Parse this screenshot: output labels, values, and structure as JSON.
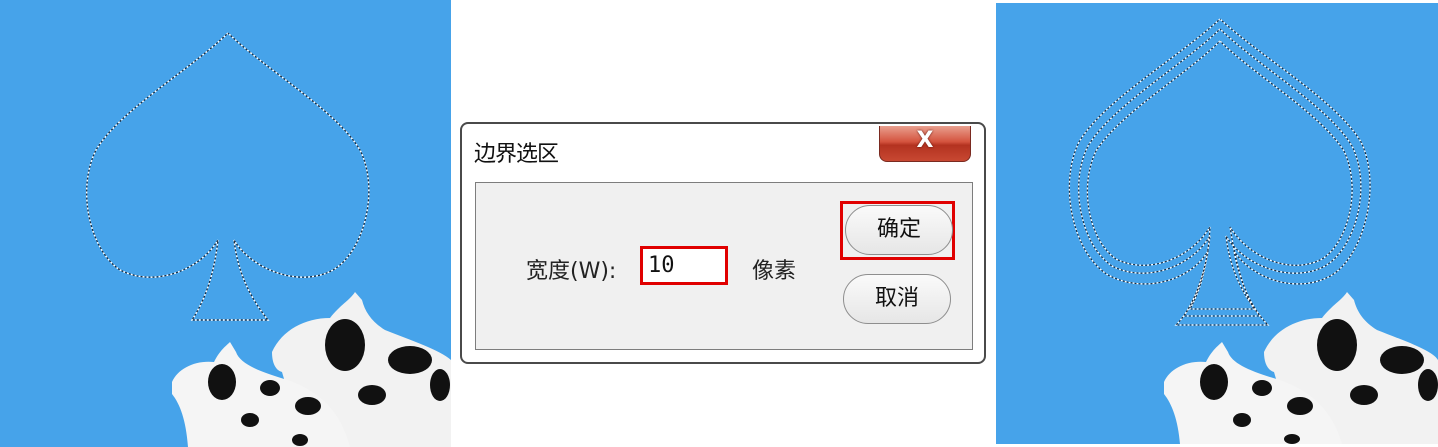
{
  "dialog": {
    "title": "边界选区",
    "close_label": "X",
    "width_label": "宽度(W):",
    "width_value": "10",
    "unit_label": "像素",
    "ok_label": "确定",
    "cancel_label": "取消"
  },
  "colors": {
    "canvas_background": "#46a3ea",
    "highlight": "#e00000",
    "close_button": "#c84832"
  },
  "icons": {
    "left_selection": "spade-selection-outline",
    "right_selection": "spade-border-selection",
    "cows": "cow-statues"
  }
}
